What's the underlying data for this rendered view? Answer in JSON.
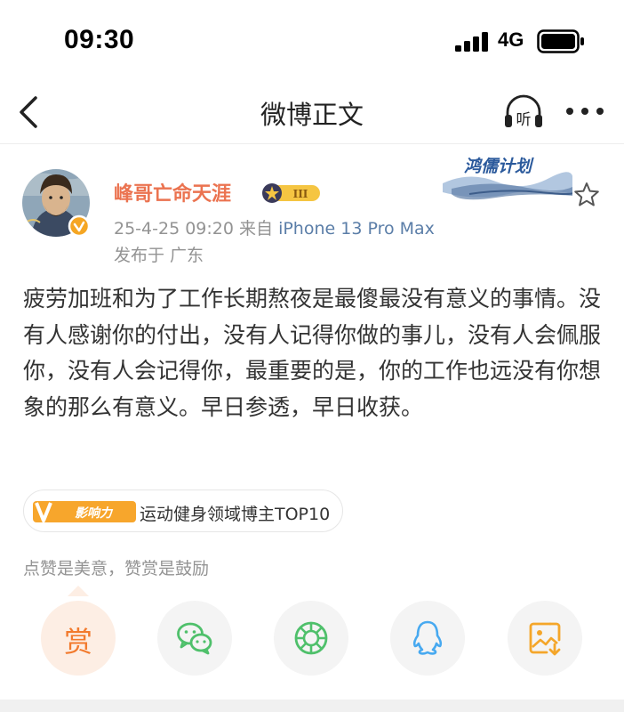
{
  "status_bar": {
    "time": "09:30",
    "network": "4G"
  },
  "nav": {
    "title": "微博正文",
    "listen_label": "听"
  },
  "post": {
    "author_name": "峰哥亡命天涯",
    "level_label": "III",
    "campaign_label": "鸿儒计划",
    "timestamp": "25-4-25 09:20",
    "source_prefix": "来自",
    "source": "iPhone 13 Pro Max",
    "location": "发布于 广东",
    "text": "疲劳加班和为了工作长期熬夜是最傻最没有意义的事情。没有人感谢你的付出，没有人记得你做的事儿，没有人会佩服你，没有人会记得你，最重要的是，你的工作也远没有你想象的那么有意义。早日参透，早日收获。"
  },
  "influence": {
    "badge_text": "影响力",
    "label": "运动健身领域博主TOP10"
  },
  "reward": {
    "hint": "点赞是美意，赞赏是鼓励",
    "button_label": "赏"
  },
  "share_targets": [
    "reward-icon",
    "wechat-icon",
    "moments-icon",
    "qq-icon",
    "save-image-icon"
  ],
  "colors": {
    "accent": "#eb7350",
    "link": "#5b7ea8",
    "reward": "#f27a2d",
    "wechat": "#4fc06b",
    "qq": "#47a9f0",
    "gold": "#f4a62a"
  }
}
